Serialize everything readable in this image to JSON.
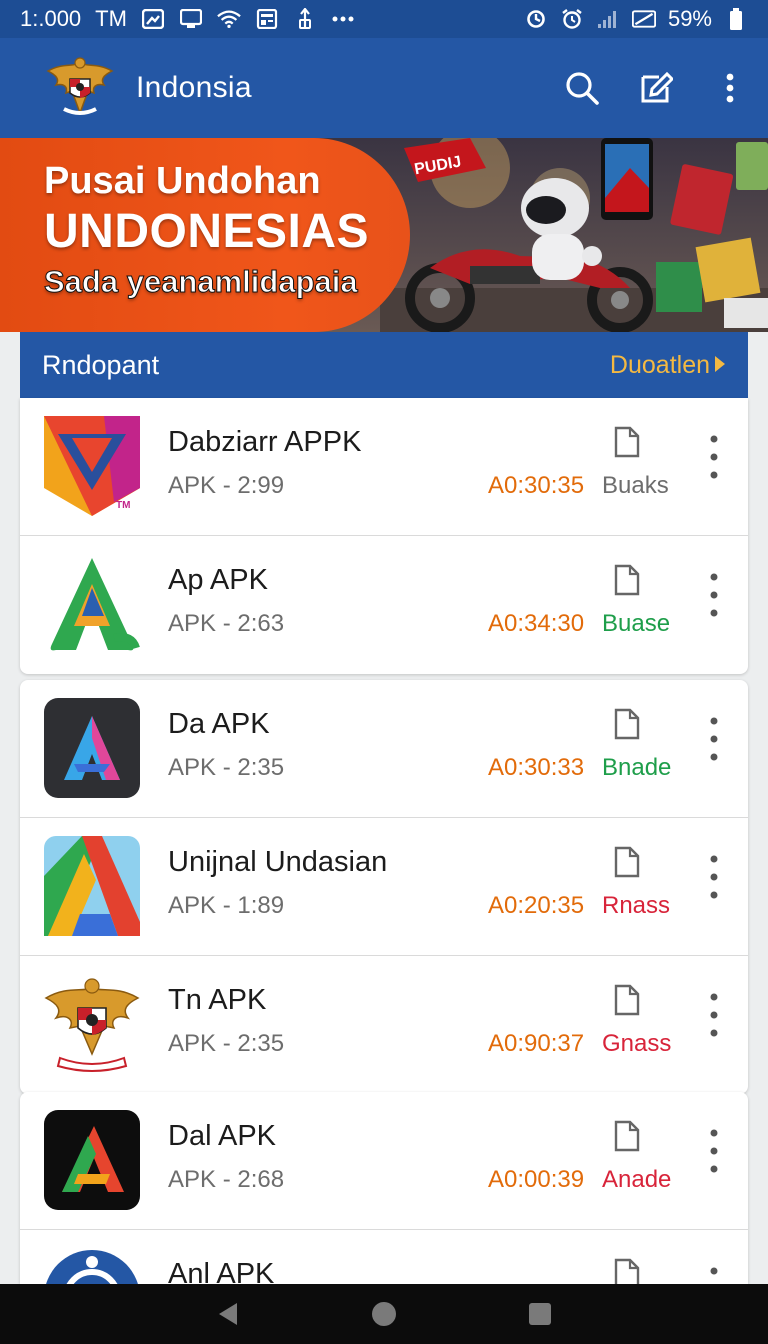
{
  "status_bar": {
    "time": "1:.000",
    "carrier": "TM",
    "battery": "59%",
    "left_icons": [
      "image-icon",
      "cast-icon",
      "wifi-icon",
      "news-icon",
      "usb-icon",
      "more-icon"
    ],
    "right_icons": [
      "sync-icon",
      "alarm-icon",
      "signal-icon",
      "battery-saver-icon",
      "battery-icon"
    ]
  },
  "app_bar": {
    "title": "Indonsia",
    "actions": [
      "search-icon",
      "edit-icon",
      "overflow-menu-icon"
    ]
  },
  "banner": {
    "line1": "Pusai Undohan",
    "line2": "UNDONESIAS",
    "line3": "Sada yeanamlidapaia",
    "flag_text": "PUDIJ"
  },
  "section": {
    "title": "Rndopant",
    "link": "Duoatlen"
  },
  "colors": {
    "primary": "#2457a5",
    "status_bar": "#1d4d94",
    "banner_orange": "#f0561a",
    "time_orange": "#e26b0a",
    "link_gold": "#f4b942",
    "status_gray": "#6d6d6d",
    "status_green": "#1e9e4a",
    "status_red": "#d8243a"
  },
  "cards": [
    {
      "items": [
        {
          "name": "Dabziarr APPK",
          "sub": "APK - 2:99",
          "time": "A0:30:35",
          "status": "Buaks",
          "status_color": "#6d6d6d",
          "icon": "red-v-shield-icon",
          "icon_tm": "TM"
        },
        {
          "name": "Ap APK",
          "sub": "APK - 2:63",
          "time": "A0:34:30",
          "status": "Buase",
          "status_color": "#1e9e4a",
          "icon": "green-a-icon"
        }
      ]
    },
    {
      "items": [
        {
          "name": "Da APK",
          "sub": "APK - 2:35",
          "time": "A0:30:33",
          "status": "Bnade",
          "status_color": "#1e9e4a",
          "icon": "dark-a-icon"
        },
        {
          "name": "Unijnal Undasian",
          "sub": "APK - 1:89",
          "time": "A0:20:35",
          "status": "Rnass",
          "status_color": "#d8243a",
          "icon": "multicolor-a-icon"
        },
        {
          "name": "Tn APK",
          "sub": "APK - 2:35",
          "time": "A0:90:37",
          "status": "Gnass",
          "status_color": "#d8243a",
          "icon": "garuda-emblem-icon"
        }
      ]
    },
    {
      "items": [
        {
          "name": "Dal APK",
          "sub": "APK - 2:68",
          "time": "A0:00:39",
          "status": "Anade",
          "status_color": "#d8243a",
          "icon": "black-a-icon"
        },
        {
          "name": "Anl APK",
          "sub": "",
          "time": "",
          "status": "",
          "status_color": "#6d6d6d",
          "icon": "blue-round-icon"
        }
      ]
    }
  ],
  "nav_bar": [
    "back-icon",
    "home-icon",
    "recents-icon"
  ]
}
